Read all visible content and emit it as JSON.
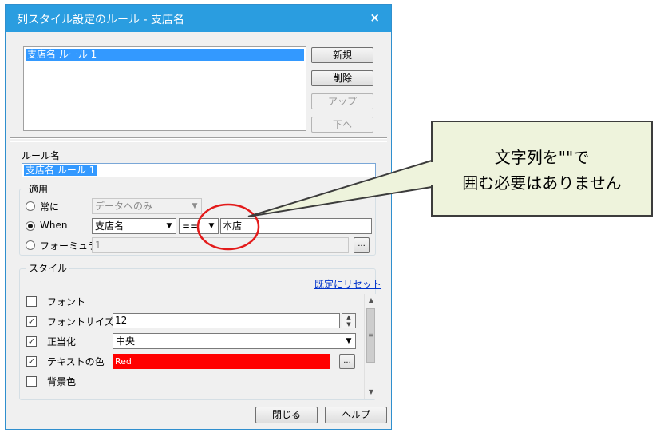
{
  "dialog": {
    "title": "列スタイル設定のルール - 支店名",
    "close_glyph": "×"
  },
  "rules": {
    "items": [
      "支店名 ルール 1"
    ],
    "buttons": {
      "new": "新規",
      "delete": "削除",
      "up": "アップ",
      "down": "下へ"
    }
  },
  "rule_name": {
    "label": "ルール名",
    "value": "支店名 ルール 1"
  },
  "apply": {
    "title": "適用",
    "always_label": "常に",
    "always_value": "データへのみ",
    "when_label": "When",
    "when_column": "支店名",
    "when_operator": "==",
    "when_value": "本店",
    "formula_label": "フォーミュラ",
    "formula_value": "1",
    "formula_button": "...",
    "selected": "when"
  },
  "style": {
    "title": "スタイル",
    "reset_link": "既定にリセット",
    "rows": {
      "font_label": "フォント",
      "fontsize_label": "フォントサイズ",
      "fontsize_value": "12",
      "justify_label": "正当化",
      "justify_value": "中央",
      "textcolor_label": "テキストの色",
      "textcolor_value": "Red",
      "textcolor_button": "...",
      "bgcolor_label": "背景色"
    }
  },
  "footer": {
    "close": "閉じる",
    "help": "ヘルプ"
  },
  "callout": {
    "line1": "文字列を\"\"で",
    "line2": "囲む必要はありません"
  },
  "colors": {
    "titlebar": "#2a9de0",
    "selection": "#3399ff",
    "text_color_swatch": "#ff0000",
    "annotation_circle": "#e31b1b",
    "callout_bg": "#eef3dc"
  }
}
